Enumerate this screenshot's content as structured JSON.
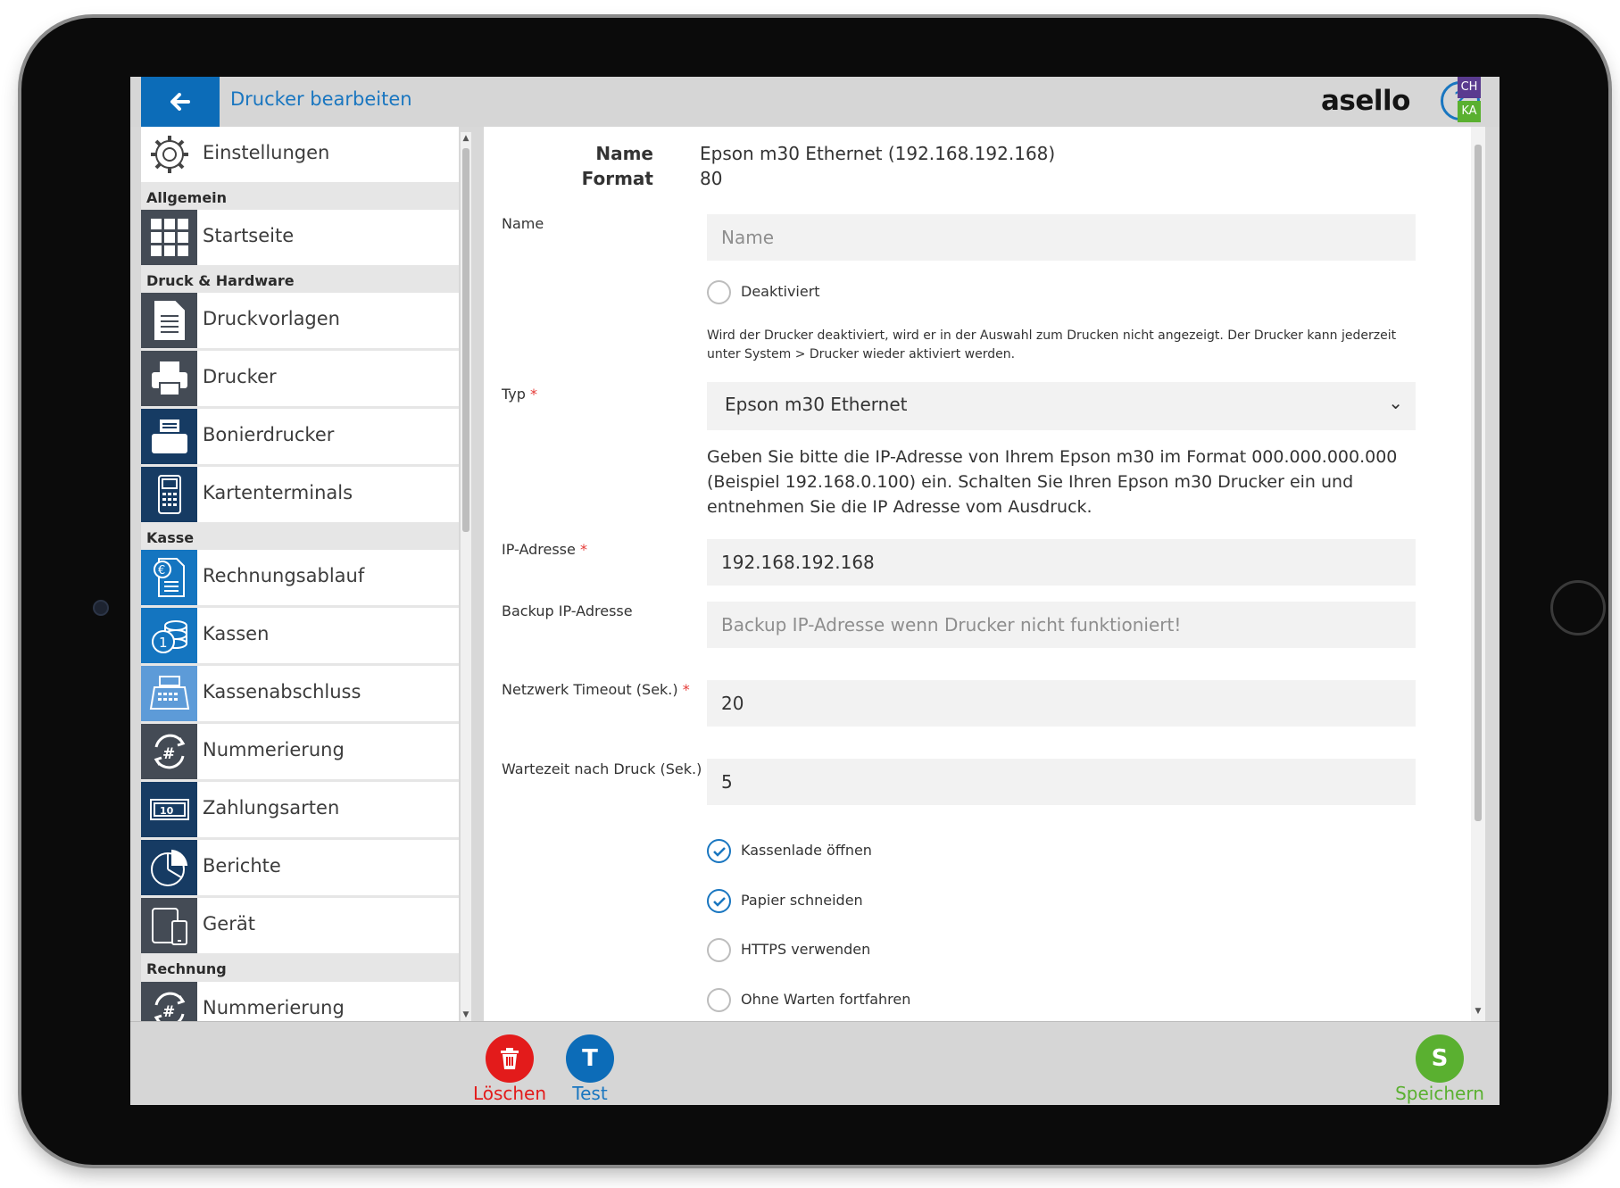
{
  "header": {
    "title": "Drucker bearbeiten",
    "logo": "asello",
    "help_symbol": "?",
    "badge_top": "CH",
    "badge_bottom": "KA",
    "accent_color": "#0c6cb8"
  },
  "sidebar": {
    "settings_label": "Einstellungen",
    "sections": {
      "allgemein": "Allgemein",
      "druck": "Druck & Hardware",
      "kasse": "Kasse",
      "rechnung": "Rechnung"
    },
    "items": [
      {
        "label": "Startseite",
        "icon": "grid-icon"
      },
      {
        "label": "Druckvorlagen",
        "icon": "document-icon"
      },
      {
        "label": "Drucker",
        "icon": "printer-icon"
      },
      {
        "label": "Bonierdrucker",
        "icon": "receipt-printer-icon"
      },
      {
        "label": "Kartenterminals",
        "icon": "card-terminal-icon"
      },
      {
        "label": "Rechnungsablauf",
        "icon": "invoice-euro-icon"
      },
      {
        "label": "Kassen",
        "icon": "coins-icon"
      },
      {
        "label": "Kassenabschluss",
        "icon": "cash-register-icon"
      },
      {
        "label": "Nummerierung",
        "icon": "hash-cycle-icon"
      },
      {
        "label": "Zahlungsarten",
        "icon": "banknote-icon"
      },
      {
        "label": "Berichte",
        "icon": "pie-chart-icon"
      },
      {
        "label": "Gerät",
        "icon": "devices-icon"
      },
      {
        "label": "Nummerierung",
        "icon": "hash-cycle-icon"
      }
    ]
  },
  "summary": {
    "name_key": "Name",
    "name_value": "Epson m30 Ethernet (192.168.192.168)",
    "format_key": "Format",
    "format_value": "80"
  },
  "form": {
    "name_label": "Name",
    "name_placeholder": "Name",
    "name_value": "",
    "deactivated_label": "Deaktiviert",
    "deactivated_checked": false,
    "deactivated_hint": "Wird der Drucker deaktiviert, wird er in der Auswahl zum Drucken nicht angezeigt. Der Drucker kann jederzeit unter System > Drucker wieder aktiviert werden.",
    "type_label": "Typ",
    "type_value": "Epson m30 Ethernet",
    "type_hint": "Geben Sie bitte die IP-Adresse von Ihrem Epson m30 im Format 000.000.000.000 (Beispiel 192.168.0.100) ein. Schalten Sie Ihren Epson m30 Drucker ein und entnehmen Sie die IP Adresse vom Ausdruck.",
    "ip_label": "IP-Adresse",
    "ip_value": "192.168.192.168",
    "backup_label": "Backup IP-Adresse",
    "backup_placeholder": "Backup IP-Adresse wenn Drucker nicht funktioniert!",
    "backup_value": "",
    "timeout_label": "Netzwerk Timeout (Sek.)",
    "timeout_value": "20",
    "wait_label": "Wartezeit nach Druck (Sek.)",
    "wait_value": "5",
    "required_mark": "*",
    "options": [
      {
        "label": "Kassenlade öffnen",
        "checked": true
      },
      {
        "label": "Papier schneiden",
        "checked": true
      },
      {
        "label": "HTTPS verwenden",
        "checked": false
      },
      {
        "label": "Ohne Warten fortfahren",
        "checked": false
      }
    ]
  },
  "footer": {
    "delete_label": "Löschen",
    "delete_color": "#e31b1b",
    "test_letter": "T",
    "test_label": "Test",
    "test_color": "#0c6cb8",
    "save_letter": "S",
    "save_label": "Speichern",
    "save_color": "#5ab030"
  }
}
